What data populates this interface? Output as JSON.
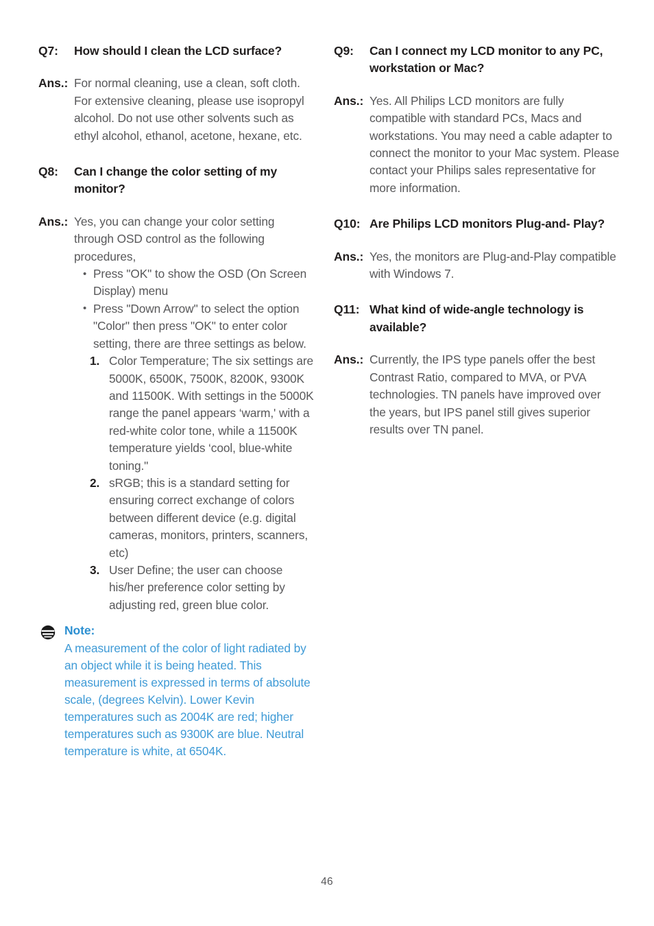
{
  "page": {
    "number": "46",
    "note_icon_name": "note-icon",
    "colors": {
      "heading": "#221f1f",
      "body": "#58585a",
      "note_title": "#2b8fd1",
      "note_body": "#3e9ad6",
      "background": "#ffffff"
    }
  },
  "left_column": {
    "q7": {
      "label": "Q7:",
      "question": "How should I clean the LCD surface?",
      "ans_label": "Ans.:",
      "answer": "For normal cleaning, use a clean, soft cloth. For extensive cleaning, please use isopropyl alcohol. Do not use other solvents such as ethyl alcohol, ethanol, acetone, hexane, etc."
    },
    "q8": {
      "label": "Q8:",
      "question": "Can I change the color setting of my monitor?",
      "ans_label": "Ans.:",
      "answer_intro": "Yes, you can change your color setting through OSD control as the following procedures,",
      "bullets": [
        "Press \"OK\" to show the OSD (On Screen Display) menu",
        "Press \"Down Arrow\" to select the option \"Color\" then press \"OK\" to enter color setting, there are three settings as below."
      ],
      "numbered": [
        {
          "num": "1.",
          "text": "Color Temperature; The six settings are 5000K, 6500K, 7500K, 8200K, 9300K and 11500K. With settings in the 5000K range the panel appears ‘warm,' with a red-white color tone, while a 11500K temperature yields ‘cool, blue-white toning.\""
        },
        {
          "num": "2.",
          "text": "sRGB; this is a standard setting for ensuring correct exchange of colors between different device (e.g. digital cameras, monitors, printers, scanners, etc)"
        },
        {
          "num": "3.",
          "text": "User Define; the user can choose his/her preference color setting by adjusting red, green blue color."
        }
      ]
    },
    "note": {
      "title": "Note:",
      "body": "A measurement of the color of light radiated by an object while it is being heated. This measurement is expressed in terms of absolute scale, (degrees Kelvin). Lower Kevin temperatures such as 2004K are red; higher temperatures such as 9300K are blue. Neutral temperature is white, at 6504K."
    }
  },
  "right_column": {
    "q9": {
      "label": "Q9:",
      "question": "Can I connect my LCD monitor to any PC, workstation or Mac?",
      "ans_label": "Ans.:",
      "answer": "Yes. All Philips LCD monitors are fully compatible with standard PCs, Macs and workstations. You may need a cable adapter to connect the monitor to your Mac system. Please contact your Philips sales representative for more information."
    },
    "q10": {
      "label": "Q10:",
      "question": "Are Philips LCD monitors Plug-and- Play?",
      "ans_label": "Ans.:",
      "answer": "Yes, the monitors are Plug-and-Play compatible with Windows 7."
    },
    "q11": {
      "label": "Q11:",
      "question": "What kind of wide-angle technology is available?",
      "ans_label": "Ans.:",
      "answer": "Currently, the IPS type panels offer the best Contrast Ratio, compared to MVA, or PVA technologies. TN panels have improved over the years, but IPS panel still gives superior results over TN panel."
    }
  }
}
